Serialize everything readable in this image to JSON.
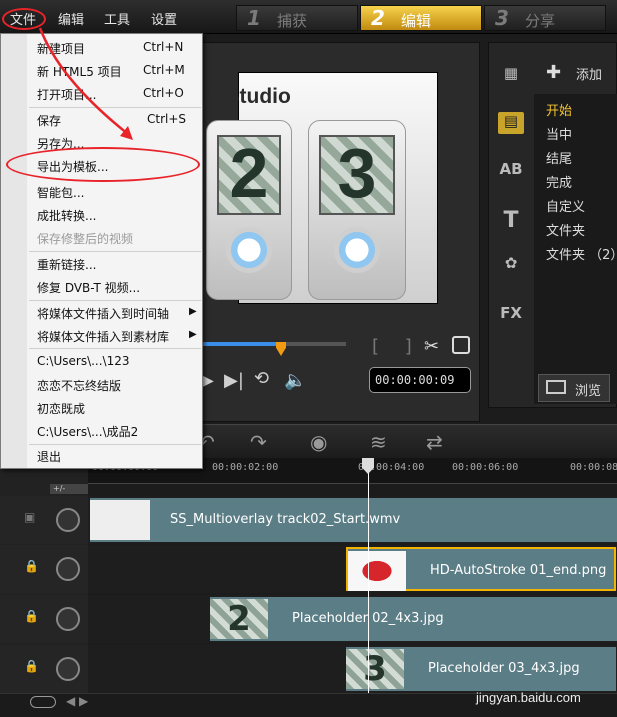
{
  "menubar": {
    "file": "文件",
    "edit": "编辑",
    "tools": "工具",
    "settings": "设置"
  },
  "steps": [
    {
      "num": "1",
      "label": "捕获"
    },
    {
      "num": "2",
      "label": "编辑"
    },
    {
      "num": "3",
      "label": "分享"
    }
  ],
  "file_menu": {
    "new_project": "新建项目",
    "new_project_sc": "Ctrl+N",
    "new_html5": "新 HTML5 项目",
    "new_html5_sc": "Ctrl+M",
    "open_project": "打开项目...",
    "open_project_sc": "Ctrl+O",
    "save": "保存",
    "save_sc": "Ctrl+S",
    "save_as": "另存为...",
    "export_template": "导出为模板...",
    "smart_package": "智能包...",
    "batch_convert": "成批转换...",
    "save_trimmed": "保存修整后的视频",
    "relink": "重新链接...",
    "repair_dvb": "修复 DVB-T 视频...",
    "insert_timeline": "将媒体文件插入到时间轴",
    "insert_library": "将媒体文件插入到素材库",
    "recent_1": "C:\\Users\\...\\123",
    "recent_2": "恋恋不忘终结版",
    "recent_3": "初恋既成",
    "recent_4": "C:\\Users\\...\\成品2",
    "exit": "退出"
  },
  "preview": {
    "brand_text": "eoStudio",
    "digit_left": "2",
    "digit_right": "3",
    "timecode": "00:00:00:09",
    "progress": 0.53
  },
  "library": {
    "add_label": "添加",
    "items": [
      "开始",
      "当中",
      "结尾",
      "完成",
      "自定义",
      "文件夹",
      "文件夹 （2）"
    ],
    "browse_label": "浏览"
  },
  "ruler": {
    "ticks": [
      "00:00:00:00",
      "00:00:02:00",
      "00:00:04:00",
      "00:00:06:00",
      "00:00:08"
    ]
  },
  "tracks": {
    "clip_1": "SS_Multioverlay track02_Start.wmv",
    "clip_2": "HD-AutoStroke 01_end.png",
    "clip_3": "Placeholder 02_4x3.jpg",
    "clip_4": "Placeholder 03_4x3.jpg",
    "thumb_3_digit": "2",
    "thumb_4_digit": "3"
  },
  "watermark": "jingyan.baidu.com",
  "colors": {
    "accent_yellow": "#f2b400",
    "annotation_red": "#e8242a",
    "clip_blue": "#5b7d86"
  }
}
